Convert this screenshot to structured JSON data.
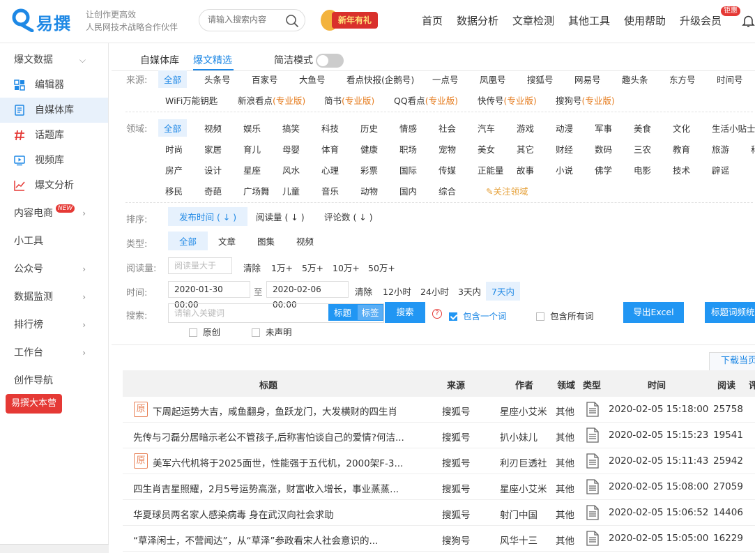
{
  "brand": {
    "name": "易撰",
    "slogan1": "让创作更高效",
    "slogan2": "人民网技术战略合作伙伴",
    "promo": "新年有礼"
  },
  "search": {
    "placeholder": "请输入搜索内容"
  },
  "nav": {
    "items": [
      "首页",
      "数据分析",
      "文章检测",
      "其他工具",
      "使用帮助",
      "升级会员"
    ],
    "vip_badge": "钜惠"
  },
  "sidebar": {
    "items": [
      {
        "label": "爆文数据",
        "chevron": "⌄"
      },
      {
        "label": "编辑器",
        "icon": "grid-icon"
      },
      {
        "label": "自媒体库",
        "icon": "doc-icon"
      },
      {
        "label": "话题库",
        "icon": "hash-icon"
      },
      {
        "label": "视频库",
        "icon": "video-icon"
      },
      {
        "label": "爆文分析",
        "icon": "chart-icon"
      },
      {
        "label": "内容电商",
        "badge": "NEW"
      },
      {
        "label": "小工具"
      },
      {
        "label": "公众号"
      },
      {
        "label": "数据监测"
      },
      {
        "label": "排行榜"
      },
      {
        "label": "工作台"
      },
      {
        "label": "创作导航"
      }
    ],
    "big_button": "易撰大本营"
  },
  "tabs": {
    "tab1": "自媒体库",
    "tab2": "爆文精选",
    "simple_mode": "简洁模式"
  },
  "filters": {
    "source_label": "来源:",
    "sources_row1": [
      "全部",
      "头条号",
      "百家号",
      "大鱼号",
      "看点快报(企鹅号)",
      "一点号",
      "凤凰号",
      "搜狐号",
      "网易号",
      "趣头条",
      "东方号",
      "时间号"
    ],
    "sources_row2": [
      {
        "name": "WiFi万能钥匙",
        "pro": ""
      },
      {
        "name": "新浪看点",
        "pro": "(专业版)"
      },
      {
        "name": "简书",
        "pro": "(专业版)"
      },
      {
        "name": "QQ看点",
        "pro": "(专业版)"
      },
      {
        "name": "快传号",
        "pro": "(专业版)"
      },
      {
        "name": "搜狗号",
        "pro": "(专业版)"
      }
    ],
    "domain_label": "领域:",
    "domains_row1": [
      "全部",
      "视频",
      "娱乐",
      "搞笑",
      "科技",
      "历史",
      "情感",
      "社会",
      "汽车",
      "游戏",
      "动漫",
      "军事",
      "美食",
      "文化",
      "生活小贴士"
    ],
    "domains_row2": [
      "时尚",
      "家居",
      "育儿",
      "母婴",
      "体育",
      "健康",
      "职场",
      "宠物",
      "美女",
      "其它",
      "财经",
      "数码",
      "三农",
      "教育",
      "旅游",
      "科"
    ],
    "domains_row3": [
      "房产",
      "设计",
      "星座",
      "风水",
      "心理",
      "彩票",
      "国际",
      "传媒",
      "正能量",
      "故事",
      "小说",
      "佛学",
      "电影",
      "技术",
      "辟谣"
    ],
    "domains_row4": [
      "移民",
      "奇葩",
      "广场舞",
      "儿童",
      "音乐",
      "动物",
      "国内",
      "综合"
    ],
    "follow_domain": "关注领域",
    "sort_label": "排序:",
    "sorts": [
      "发布时间 ( ↓ )",
      "阅读量 ( ↓ )",
      "评论数 ( ↓ )"
    ],
    "type_label": "类型:",
    "types": [
      "全部",
      "文章",
      "图集",
      "视频"
    ],
    "reads_label": "阅读量:",
    "reads_placeholder": "阅读量大于",
    "clear": "清除",
    "reads_options": [
      "1万+",
      "5万+",
      "10万+",
      "50万+"
    ],
    "time_label": "时间:",
    "time_from": "2020-01-30 00:00",
    "time_to_sep": "至",
    "time_to": "2020-02-06 00:00",
    "time_options": [
      "12小时",
      "24小时",
      "3天内",
      "7天内"
    ],
    "search_label": "搜索:",
    "keyword_placeholder": "请输入关键词",
    "mode_title": "标题",
    "mode_tag": "标签",
    "search_btn": "搜索",
    "help": "?",
    "include_one": "包含一个词",
    "include_all": "包含所有词",
    "export_btn": "导出Excel",
    "stats_btn": "标题词频统计",
    "original": "原创",
    "undeclared": "未声明"
  },
  "table": {
    "download_tab": "下载当页",
    "columns": [
      "标题",
      "来源",
      "作者",
      "领域",
      "类型",
      "时间",
      "阅读",
      "评"
    ],
    "original_mark": "原",
    "rows": [
      {
        "title": "下周起运势大吉，咸鱼翻身，鱼跃龙门，大发横财的四生肖",
        "source": "搜狐号",
        "author": "星座小艾米",
        "domain": "其他",
        "time": "2020-02-05 15:18:00",
        "reads": "25758",
        "original": true
      },
      {
        "title": "先传与刁磊分居暗示老公不管孩子,后称害怕谈自己的爱情?何洁...",
        "source": "搜狐号",
        "author": "扒小妹儿",
        "domain": "其他",
        "time": "2020-02-05 15:15:23",
        "reads": "19541",
        "original": false
      },
      {
        "title": "美军六代机将于2025面世，性能强于五代机，2000架F-3...",
        "source": "搜狐号",
        "author": "利刃巨透社",
        "domain": "其他",
        "time": "2020-02-05 15:11:43",
        "reads": "25942",
        "original": true
      },
      {
        "title": "四生肖吉星照耀，2月5号运势高涨，财富收入增长，事业蒸蒸...",
        "source": "搜狐号",
        "author": "星座小艾米",
        "domain": "其他",
        "time": "2020-02-05 15:08:00",
        "reads": "27059",
        "original": false
      },
      {
        "title": "华夏球员两名家人感染病毒 身在武汉向社会求助",
        "source": "搜狐号",
        "author": "射门中国",
        "domain": "其他",
        "time": "2020-02-05 15:06:52",
        "reads": "14406",
        "original": false
      },
      {
        "title": "“草泽闲士，不营闻达”，从“草泽”参政看宋人社会意识的...",
        "source": "搜狗号",
        "author": "风华十三",
        "domain": "其他",
        "time": "2020-02-05 15:05:00",
        "reads": "16229",
        "original": false
      }
    ]
  },
  "colors": {
    "accent": "#1e88e5",
    "brand_red": "#e53935",
    "pro_orange": "#e67e22"
  }
}
